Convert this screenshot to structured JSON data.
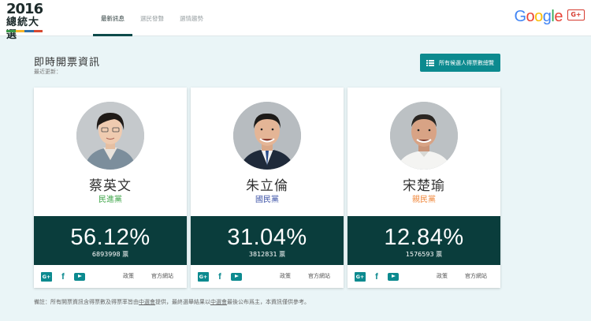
{
  "header": {
    "logo": {
      "year": "2016",
      "title": "總統大選",
      "bar_colors": [
        "#3a9b47",
        "#f6b52b",
        "#2f6fa8",
        "#d64a32"
      ]
    },
    "nav": [
      {
        "label": "最新訊息",
        "active": true
      },
      {
        "label": "選民發聲",
        "active": false
      },
      {
        "label": "選情趨勢",
        "active": false
      }
    ],
    "google": {
      "letters": [
        "G",
        "o",
        "o",
        "g",
        "l",
        "e"
      ],
      "colors": [
        "#4285f4",
        "#ea4335",
        "#fbbc05",
        "#4285f4",
        "#34a853",
        "#ea4335"
      ]
    },
    "gplus_label": "G+"
  },
  "main": {
    "title": "即時開票資訊",
    "updated_label": "最近更新：",
    "all_button": "所有候選人得票數總覽"
  },
  "candidates": [
    {
      "name": "蔡英文",
      "party": "民進黨",
      "party_color": "#3fa64a",
      "percent": "56.12%",
      "votes": "6893998 票",
      "links": [
        "政策",
        "官方網站"
      ]
    },
    {
      "name": "朱立倫",
      "party": "國民黨",
      "party_color": "#3f55a8",
      "percent": "31.04%",
      "votes": "3812831 票",
      "links": [
        "政策",
        "官方網站"
      ]
    },
    {
      "name": "宋楚瑜",
      "party": "親民黨",
      "party_color": "#f0883d",
      "percent": "12.84%",
      "votes": "1576593 票",
      "links": [
        "政策",
        "官方網站"
      ]
    }
  ],
  "social_icons": [
    "google-plus-icon",
    "facebook-icon",
    "youtube-icon"
  ],
  "footer": {
    "prefix": "備註：所有開票資訊含得票數及得票率皆由",
    "source1": "中選會",
    "middle": "提供，最終選舉結果以",
    "source2": "中選會",
    "suffix": "最後公布爲主，本資訊僅供參考。"
  },
  "colors": {
    "accent": "#0c8a8f",
    "result_bg": "#0a3d3c",
    "page_bg": "#eaf5f7"
  }
}
